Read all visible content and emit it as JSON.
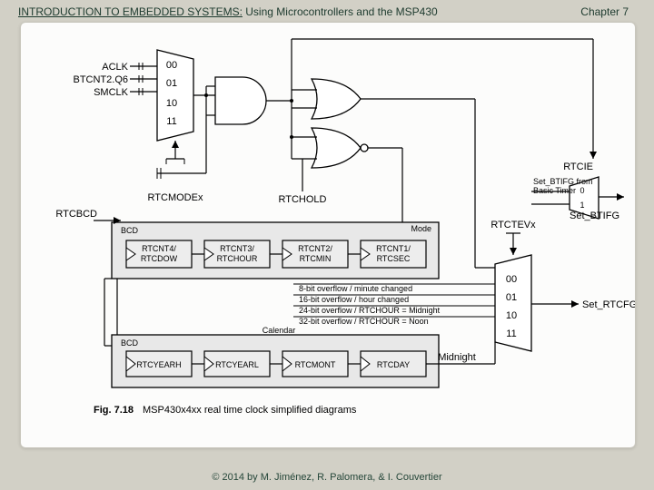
{
  "header": {
    "title_u": "INTRODUCTION TO EMBEDDED SYSTEMS:",
    "title_rest": " Using Microcontrollers and the MSP430",
    "chapter": "Chapter 7"
  },
  "footer": "© 2014 by M. Jiménez, R. Palomera, & I. Couvertier",
  "caption": {
    "num": "Fig. 7.18",
    "text": "MSP430x4xx real time clock simplified diagrams"
  },
  "mux_in": {
    "codes": [
      "00",
      "01",
      "10",
      "11"
    ],
    "srcs": [
      "ACLK",
      "BTCNT2.Q6",
      "SMCLK"
    ]
  },
  "mux_out": {
    "codes": [
      "00",
      "01",
      "10",
      "11"
    ]
  },
  "mux_bt": {
    "codes": [
      "0",
      "1"
    ]
  },
  "labels": {
    "rtcmodex": "RTCMODEx",
    "rtchold": "RTCHOLD",
    "rtcbcd": "RTCBCD",
    "mode": "Mode",
    "calendar": "Calendar",
    "bcd": "BCD",
    "midnight": "Midnight",
    "rtctevx": "RTCTEVx",
    "rtcie": "RTCIE",
    "set_btifg_from": "Set_BTIFG from",
    "basic_timer": "Basic Timer",
    "set_btifg": "Set_BTIFG",
    "set_rtcfg": "Set_RTCFG"
  },
  "row1": [
    {
      "a": "RTCNT4/",
      "b": "RTCDOW"
    },
    {
      "a": "RTCNT3/",
      "b": "RTCHOUR"
    },
    {
      "a": "RTCNT2/",
      "b": "RTCMIN"
    },
    {
      "a": "RTCNT1/",
      "b": "RTCSEC"
    }
  ],
  "row2": [
    "RTCYEARH",
    "RTCYEARL",
    "RTCMONT",
    "RTCDAY"
  ],
  "overflow": [
    "8-bit overflow / minute changed",
    "16-bit overflow / hour changed",
    "24-bit overflow / RTCHOUR = Midnight",
    "32-bit overflow / RTCHOUR = Noon"
  ]
}
